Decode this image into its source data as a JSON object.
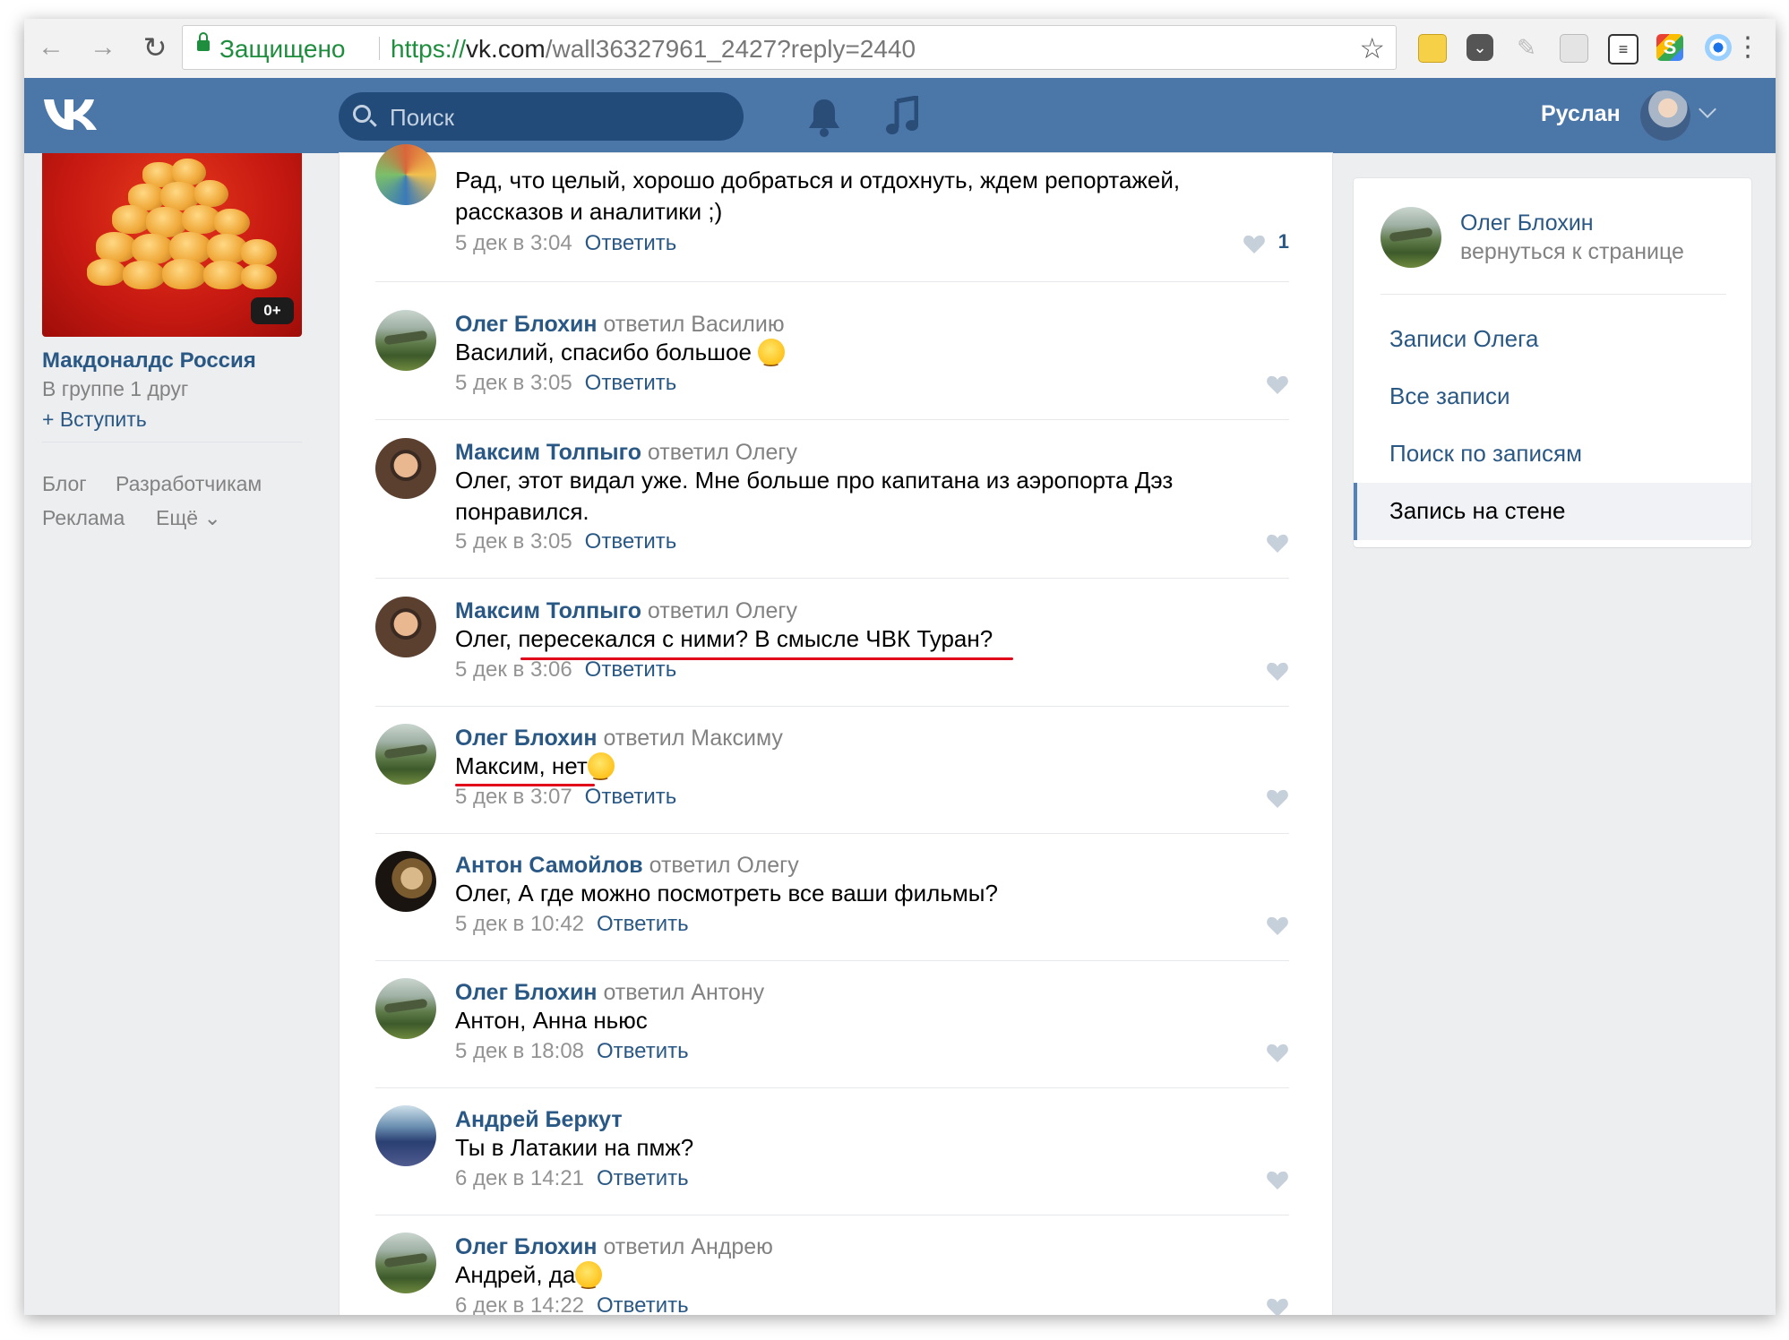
{
  "browser": {
    "secure_label": "Защищено",
    "url_scheme": "https://",
    "url_host": "vk.com",
    "url_path": "/wall36327961_2427?reply=2440"
  },
  "header": {
    "search_placeholder": "Поиск",
    "user_name": "Руслан"
  },
  "left": {
    "age_badge": "0+",
    "group_name": "Макдоналдс Россия",
    "group_friends": "В группе 1 друг",
    "join": "+ Вступить",
    "footer": {
      "blog": "Блог",
      "developers": "Разработчикам",
      "ads": "Реклама",
      "more": "Ещё ⌄"
    }
  },
  "replies": [
    {
      "author": "",
      "replied_to": "",
      "text": "Рад, что целый, хорошо добраться и отдохнуть, ждем репортажей, рассказов и аналитики ;)",
      "date": "5 дек в 3:04",
      "answer": "Ответить",
      "likes": "1"
    },
    {
      "author": "Олег Блохин",
      "replied_to": "ответил Василию",
      "text": "Василий, спасибо большое",
      "date": "5 дек в 3:05",
      "answer": "Ответить"
    },
    {
      "author": "Максим Толпыго",
      "replied_to": "ответил Олегу",
      "text": "Олег, этот видал уже. Мне больше про капитана из аэропорта Дэз понравился.",
      "date": "5 дек в 3:05",
      "answer": "Ответить"
    },
    {
      "author": "Максим Толпыго",
      "replied_to": "ответил Олегу",
      "text": "Олег, пересекался с ними? В смысле ЧВК Туран?",
      "date": "5 дек в 3:06",
      "answer": "Ответить"
    },
    {
      "author": "Олег Блохин",
      "replied_to": "ответил Максиму",
      "text": "Максим, нет",
      "date": "5 дек в 3:07",
      "answer": "Ответить"
    },
    {
      "author": "Антон Самойлов",
      "replied_to": "ответил Олегу",
      "text": "Олег, А где можно посмотреть все ваши фильмы?",
      "date": "5 дек в 10:42",
      "answer": "Ответить"
    },
    {
      "author": "Олег Блохин",
      "replied_to": "ответил Антону",
      "text": "Антон, Анна ньюс",
      "date": "5 дек в 18:08",
      "answer": "Ответить"
    },
    {
      "author": "Андрей Беркут",
      "replied_to": "",
      "text": "Ты в Латакии на пмж?",
      "date": "6 дек в 14:21",
      "answer": "Ответить"
    },
    {
      "author": "Олег Блохин",
      "replied_to": "ответил Андрею",
      "text": "Андрей, да",
      "date": "6 дек в 14:22",
      "answer": "Ответить"
    }
  ],
  "right": {
    "owner_name": "Олег Блохин",
    "back_to_page": "вернуться к странице",
    "nav": [
      "Записи Олега",
      "Все записи",
      "Поиск по записям",
      "Запись на стене"
    ]
  },
  "colors": {
    "vk_blue": "#4a76a8",
    "link": "#2a5885",
    "secure_green": "#1e8e3e",
    "highlight_red": "#e0001a"
  }
}
